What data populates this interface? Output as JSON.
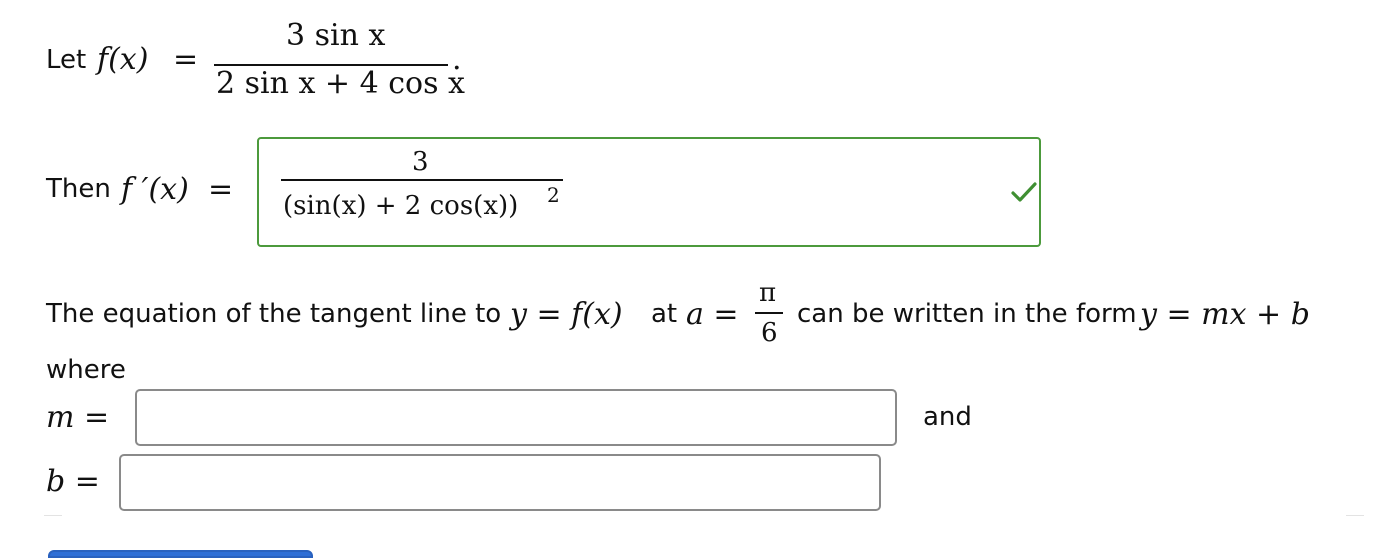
{
  "line1": {
    "let_label": "Let",
    "lhs": "f(x)",
    "eq": "=",
    "numerator": "3 sin x",
    "denominator": "2 sin x + 4 cos x",
    "period": "."
  },
  "line2": {
    "then_label": "Then",
    "lhs": "f ′(x)",
    "eq": "=",
    "answer": {
      "numerator": "3",
      "denominator": "(sin(x) + 2 cos(x))",
      "exponent": "2",
      "status": "correct"
    }
  },
  "line3": {
    "part1": "The equation of the tangent line to",
    "y_eq_fx": "y = f(x)",
    "part2": "at",
    "a_eq": "a =",
    "pi_num": "π",
    "pi_den": "6",
    "part3": "can be written in the form",
    "form": "y = mx + b"
  },
  "where_label": "where",
  "m_row": {
    "label": "m =",
    "value": "",
    "suffix": "and"
  },
  "b_row": {
    "label": "b =",
    "value": ""
  },
  "colors": {
    "correct_border": "#4c9a3c",
    "check": "#3f8f32",
    "input_border": "#8a8a8a",
    "submit": "#2f6fd6"
  }
}
